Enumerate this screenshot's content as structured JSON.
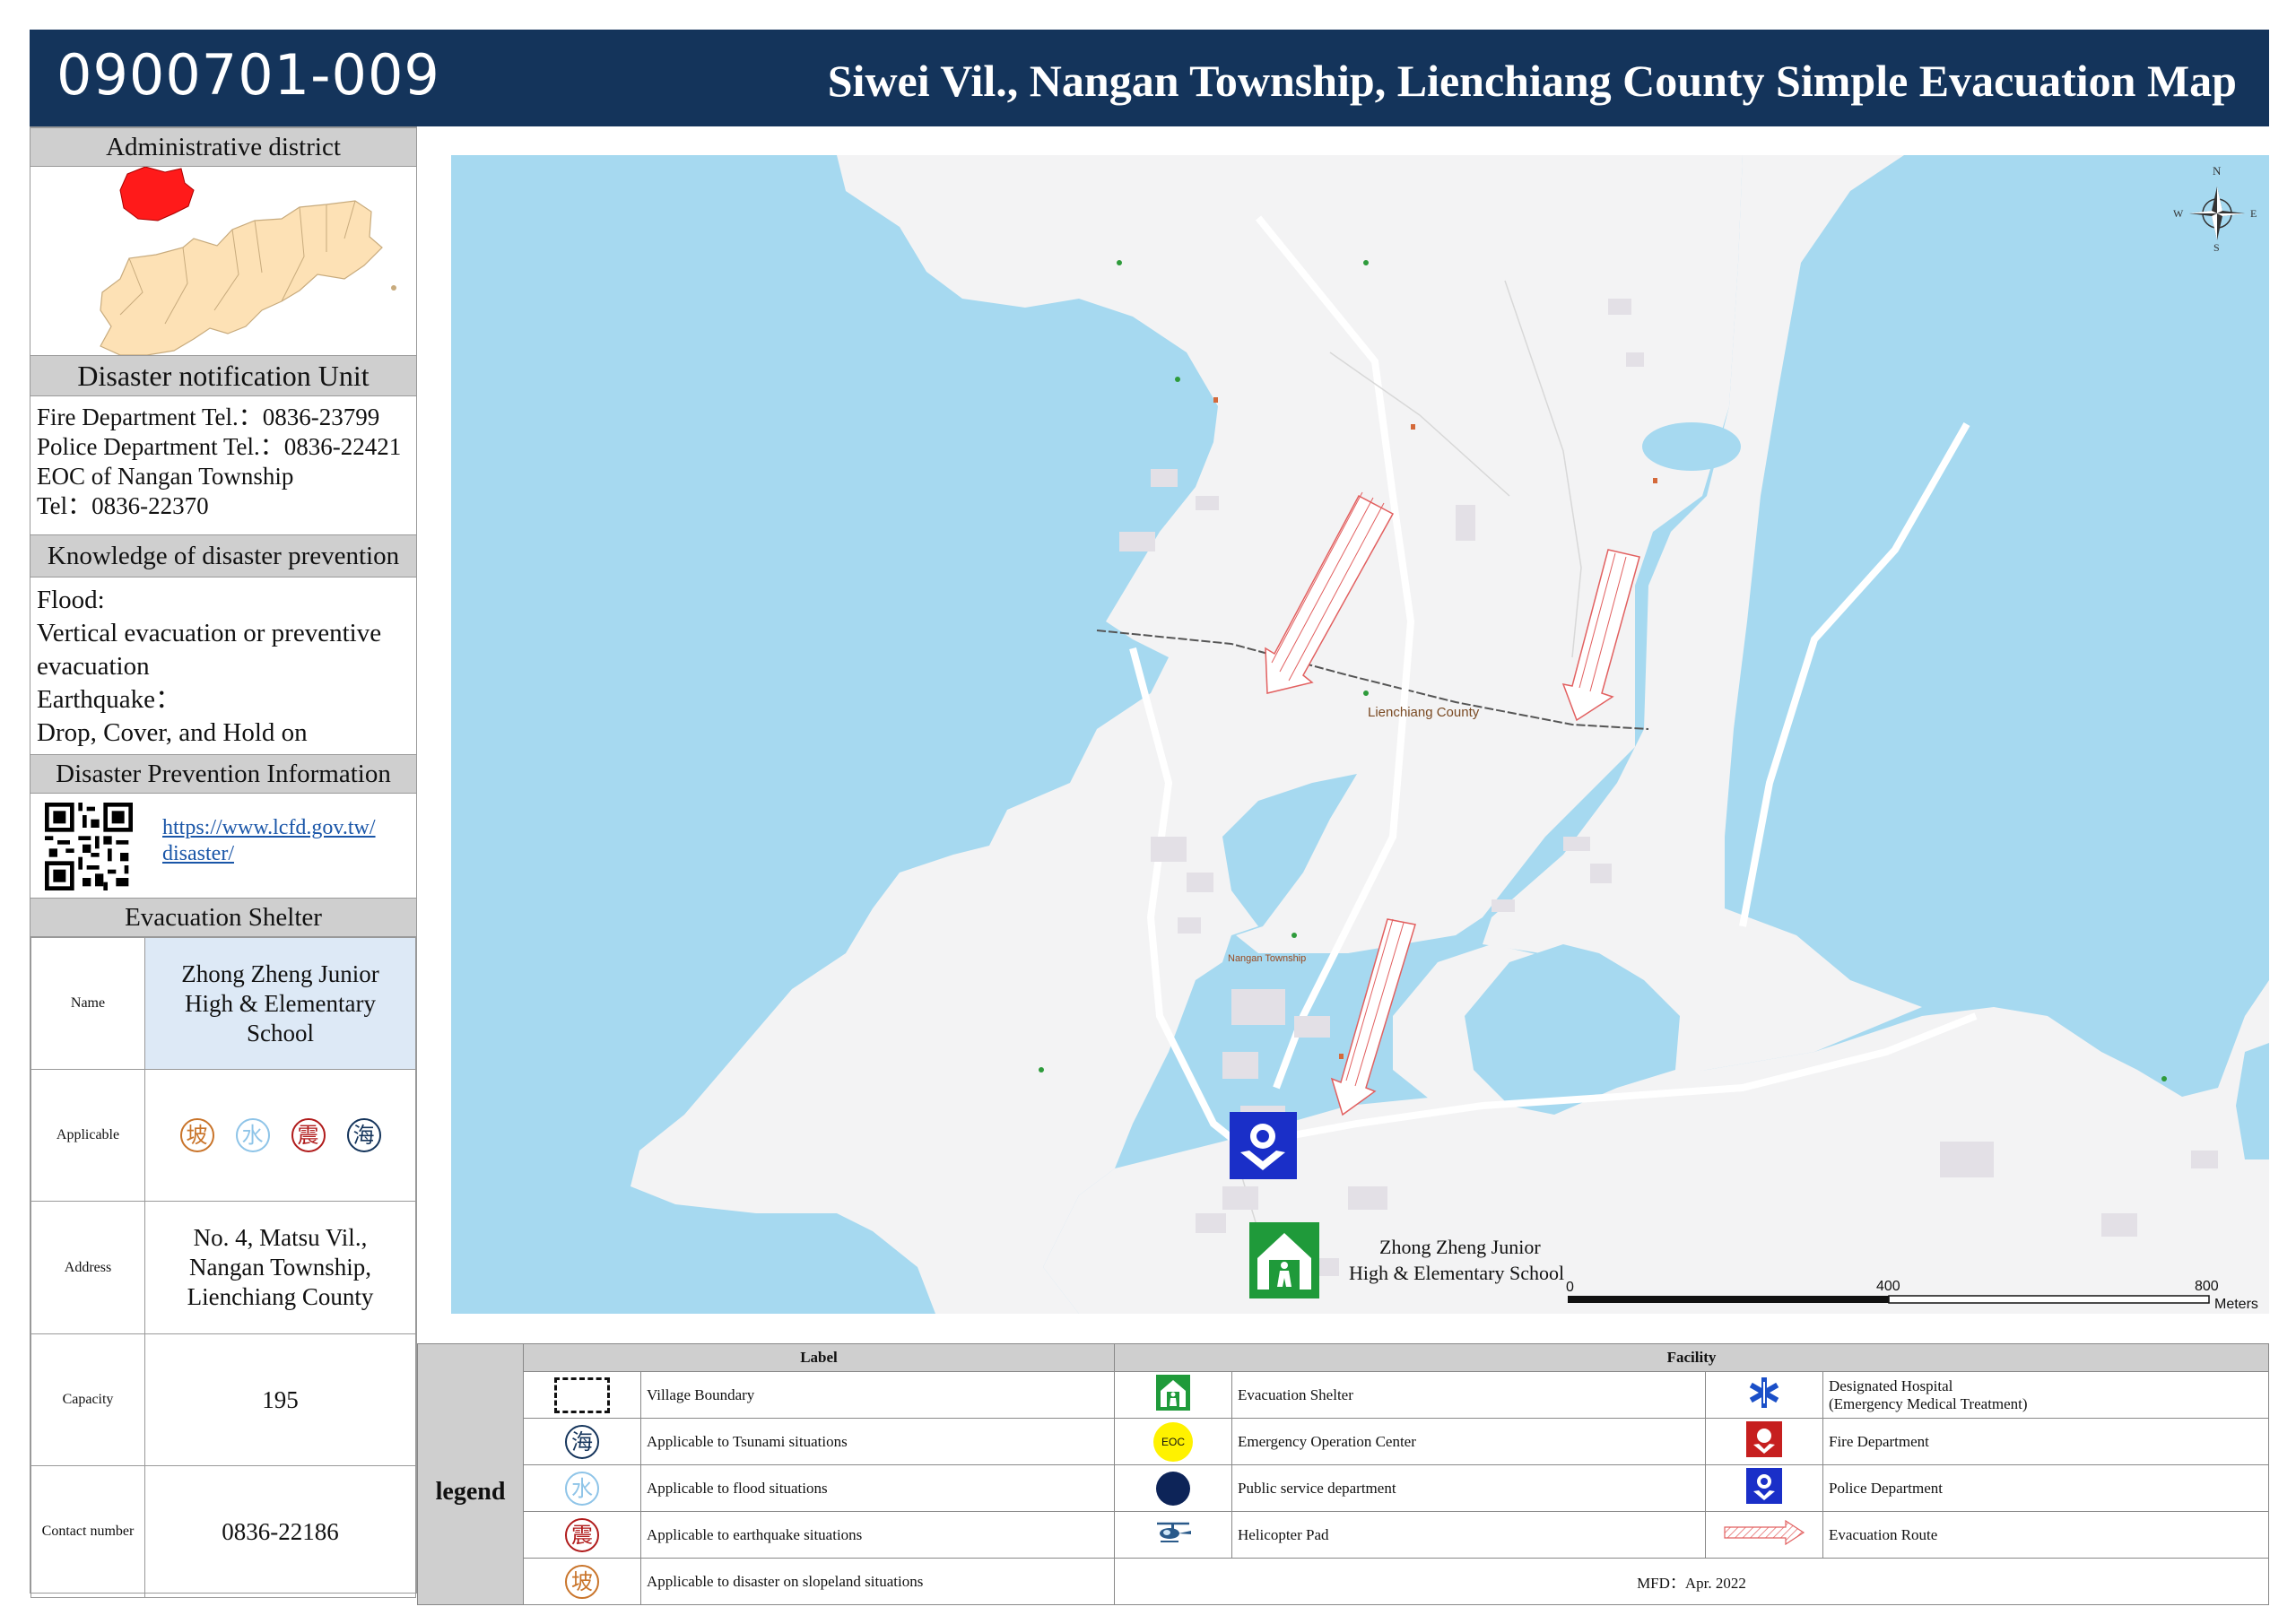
{
  "header": {
    "map_id": "0900701-009",
    "title": "Siwei Vil., Nangan Township, Lienchiang County Simple Evacuation Map"
  },
  "left_panel": {
    "admin_district": {
      "title": "Administrative district"
    },
    "notification": {
      "title": "Disaster notification Unit",
      "lines": [
        "Fire Department Tel.：0836-23799",
        "Police Department Tel.：0836-22421",
        "EOC of Nangan Township",
        "Tel：0836-22370"
      ]
    },
    "knowledge": {
      "title": "Knowledge of disaster prevention",
      "lines": [
        "Flood:",
        "Vertical evacuation or preventive evacuation",
        "Earthquake：",
        "Drop, Cover, and Hold on"
      ]
    },
    "prevention_info": {
      "title": "Disaster Prevention Information",
      "link_line1": "https://www.lcfd.gov.tw/",
      "link_line2": "disaster/"
    },
    "shelter": {
      "title": "Evacuation Shelter",
      "name_label": "Name",
      "name": "Zhong Zheng Junior High & Elementary School",
      "applicable_label": "Applicable",
      "applicable_icons": [
        "坡",
        "水",
        "震",
        "海"
      ],
      "address_label": "Address",
      "address": "No. 4, Matsu Vil., Nangan Township, Lienchiang County",
      "capacity_label": "Capacity",
      "capacity": "195",
      "contact_label": "Contact number",
      "contact": "0836-22186"
    }
  },
  "map": {
    "county_label": "Lienchiang County",
    "township_label": "Nangan Township",
    "shelter_label_line1": "Zhong Zheng Junior",
    "shelter_label_line2": "High & Elementary School",
    "scale": {
      "zero": "0",
      "mid": "400",
      "max": "800",
      "unit": "Meters"
    },
    "compass": {
      "n": "N",
      "s": "S",
      "e": "E",
      "w": "W"
    },
    "colors": {
      "water": "#a6d9f0",
      "land": "#f3f3f4",
      "route": "#e26060",
      "shelter": "#1f9a3a",
      "police": "#1a2fc8"
    }
  },
  "legend": {
    "side_label": "legend",
    "label_header": "Label",
    "facility_header": "Facility",
    "labels": [
      {
        "icon": "village-boundary",
        "text": "Village Boundary"
      },
      {
        "icon": "海",
        "text": "Applicable to Tsunami situations"
      },
      {
        "icon": "水",
        "text": "Applicable to flood situations"
      },
      {
        "icon": "震",
        "text": "Applicable to earthquake situations"
      },
      {
        "icon": "坡",
        "text": "Applicable to disaster on slopeland situations"
      }
    ],
    "facilities_left": [
      {
        "icon": "evacuation-shelter",
        "text": "Evacuation Shelter"
      },
      {
        "icon": "EOC",
        "text": "Emergency Operation Center"
      },
      {
        "icon": "public-service",
        "text": "Public service department"
      },
      {
        "icon": "helicopter-pad",
        "text": "Helicopter Pad"
      }
    ],
    "facilities_right": [
      {
        "icon": "hospital",
        "text_line1": "Designated Hospital",
        "text_line2": "(Emergency Medical Treatment)"
      },
      {
        "icon": "fire-department",
        "text": "Fire Department"
      },
      {
        "icon": "police-department",
        "text": "Police Department"
      },
      {
        "icon": "evacuation-route",
        "text": "Evacuation Route"
      }
    ],
    "mfd": "MFD：Apr. 2022"
  }
}
